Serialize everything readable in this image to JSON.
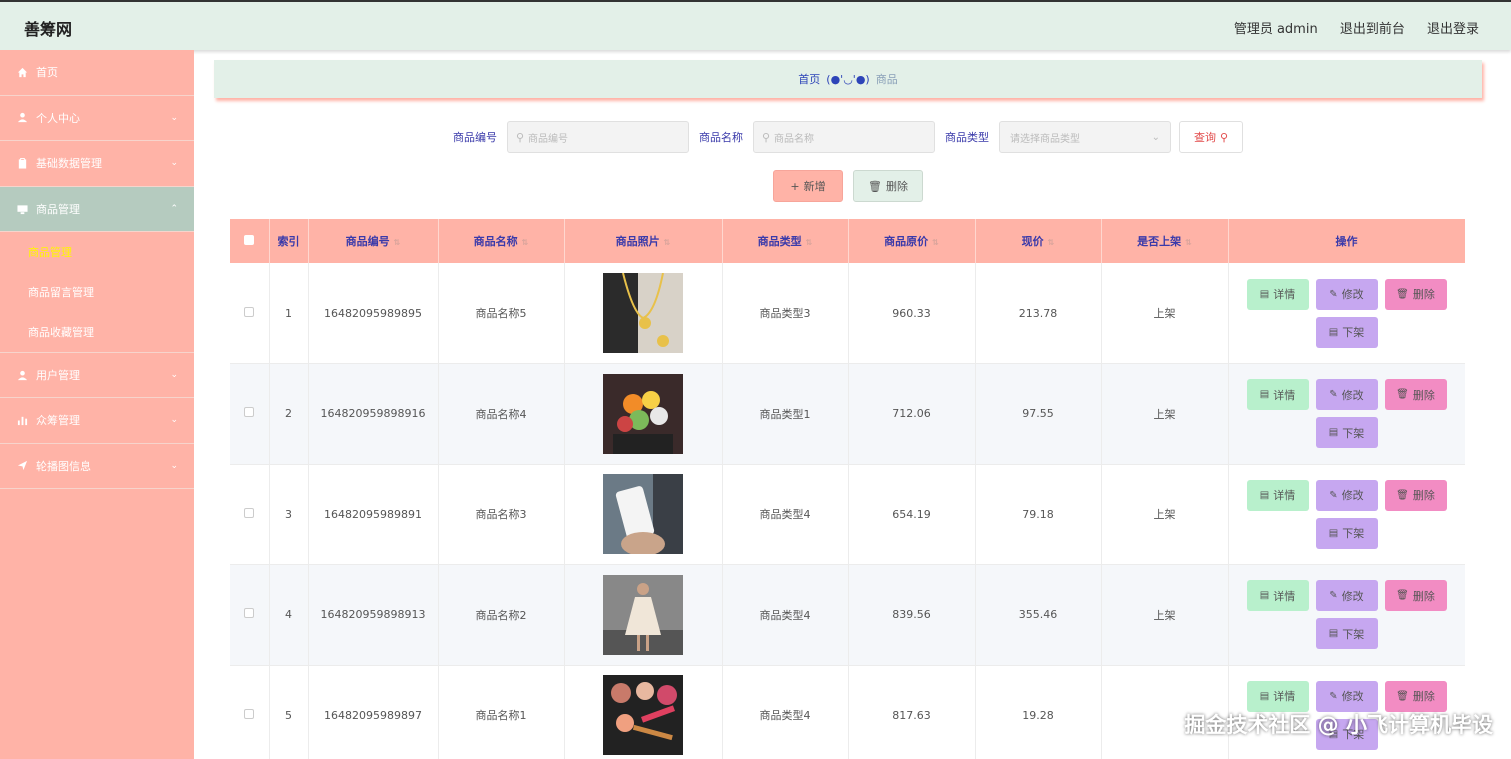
{
  "header": {
    "logo": "善筹网",
    "admin": "管理员 admin",
    "to_front": "退出到前台",
    "logout": "退出登录"
  },
  "sidebar": {
    "items": [
      {
        "label": "首页",
        "icon": "home-icon",
        "expandable": false
      },
      {
        "label": "个人中心",
        "icon": "user-icon",
        "expandable": true
      },
      {
        "label": "基础数据管理",
        "icon": "clipboard-icon",
        "expandable": true
      },
      {
        "label": "商品管理",
        "icon": "monitor-icon",
        "expandable": true,
        "active": true
      },
      {
        "label": "用户管理",
        "icon": "user-icon",
        "expandable": true
      },
      {
        "label": "众筹管理",
        "icon": "bar-chart-icon",
        "expandable": true
      },
      {
        "label": "轮播图信息",
        "icon": "send-icon",
        "expandable": true
      }
    ],
    "subitems": [
      {
        "label": "商品管理",
        "current": true
      },
      {
        "label": "商品留言管理"
      },
      {
        "label": "商品收藏管理"
      }
    ]
  },
  "breadcrumb": {
    "home": "首页",
    "sep": "(●'◡'●)",
    "current": "商品"
  },
  "search": {
    "code_label": "商品编号",
    "code_placeholder": "商品编号",
    "name_label": "商品名称",
    "name_placeholder": "商品名称",
    "type_label": "商品类型",
    "type_placeholder": "请选择商品类型",
    "query_button": "查询"
  },
  "actions": {
    "add": "新增",
    "delete": "删除"
  },
  "table": {
    "headers": [
      "索引",
      "商品编号",
      "商品名称",
      "商品照片",
      "商品类型",
      "商品原价",
      "现价",
      "是否上架",
      "操作"
    ],
    "rows": [
      {
        "index": "1",
        "code": "16482095989895",
        "name": "商品名称5",
        "photo": "necklace",
        "type": "商品类型3",
        "orig": "960.33",
        "price": "213.78",
        "status": "上架"
      },
      {
        "index": "2",
        "code": "164820959898916",
        "name": "商品名称4",
        "photo": "flowers",
        "type": "商品类型1",
        "orig": "712.06",
        "price": "97.55",
        "status": "上架"
      },
      {
        "index": "3",
        "code": "16482095989891",
        "name": "商品名称3",
        "photo": "phone",
        "type": "商品类型4",
        "orig": "654.19",
        "price": "79.18",
        "status": "上架"
      },
      {
        "index": "4",
        "code": "164820959898913",
        "name": "商品名称2",
        "photo": "dress",
        "type": "商品类型4",
        "orig": "839.56",
        "price": "355.46",
        "status": "上架"
      },
      {
        "index": "5",
        "code": "16482095989897",
        "name": "商品名称1",
        "photo": "cosmetics",
        "type": "商品类型4",
        "orig": "817.63",
        "price": "19.28",
        "status": ""
      }
    ],
    "ops": {
      "detail": "详情",
      "edit": "修改",
      "del": "删除",
      "off": "下架"
    }
  },
  "watermark": "掘金技术社区 @ 小飞计算机毕设",
  "colors": {
    "sidebar": "#ffb3a7",
    "header": "#e3f0e8",
    "accent_text": "#3a3aaa",
    "detail": "#b8f0cc",
    "edit": "#c6a7f0",
    "delete": "#f28cc3"
  }
}
